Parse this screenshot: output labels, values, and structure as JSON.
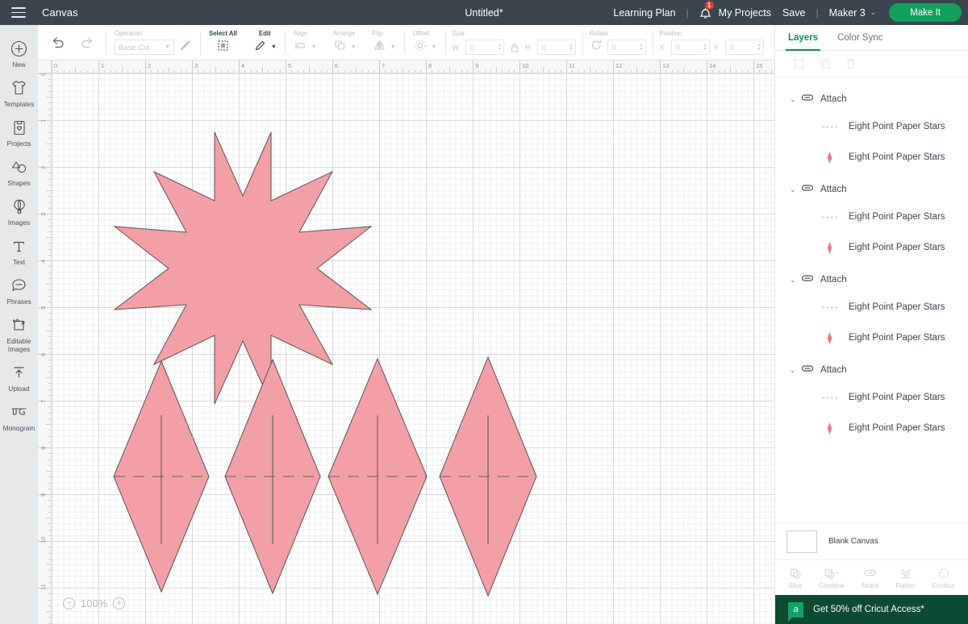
{
  "topbar": {
    "menu_icon": "hamburger-icon",
    "canvas_label": "Canvas",
    "title": "Untitled*",
    "learning_plan": "Learning Plan",
    "separator": "|",
    "bell_icon": "notification-bell-icon",
    "badge_count": "1",
    "my_projects": "My Projects",
    "save": "Save",
    "separator2": "|",
    "machine": "Maker 3",
    "chevron": "⌄",
    "make_it": "Make It",
    "bg_color": "#3c444d",
    "accent_green": "#12a05c"
  },
  "rail": {
    "items": [
      {
        "label": "New",
        "icon": "plus-circle-icon"
      },
      {
        "label": "Templates",
        "icon": "tshirt-icon"
      },
      {
        "label": "Projects",
        "icon": "projects-card-icon"
      },
      {
        "label": "Shapes",
        "icon": "shapes-icon"
      },
      {
        "label": "Images",
        "icon": "hot-air-balloon-icon"
      },
      {
        "label": "Text",
        "icon": "text-t-icon"
      },
      {
        "label": "Phrases",
        "icon": "speech-bubble-icon"
      },
      {
        "label": "Editable Images",
        "icon": "editable-images-icon"
      },
      {
        "label": "Upload",
        "icon": "upload-arrow-icon"
      },
      {
        "label": "Monogram",
        "icon": "monogram-icon"
      }
    ]
  },
  "toolbar": {
    "undo_icon": "undo-arrow-icon",
    "redo_icon": "redo-arrow-icon",
    "operation": {
      "label": "Operation",
      "value": "Basic Cut",
      "swatch_icon": "pen-stroke-icon"
    },
    "select_all": {
      "label": "Select All",
      "icon": "select-all-icon"
    },
    "edit": {
      "label": "Edit",
      "icon": "pencil-icon"
    },
    "align": {
      "label": "Align",
      "icon": "align-icon"
    },
    "arrange": {
      "label": "Arrange",
      "icon": "arrange-icon"
    },
    "flip": {
      "label": "Flip",
      "icon": "flip-icon"
    },
    "offset": {
      "label": "Offset",
      "icon": "offset-icon"
    },
    "size": {
      "label": "Size",
      "lock_icon": "lock-icon",
      "w_label": "W",
      "w_value": "0",
      "h_label": "H",
      "h_value": "0"
    },
    "rotate": {
      "label": "Rotate",
      "icon": "rotate-icon",
      "value": "0"
    },
    "position": {
      "label": "Position",
      "x_label": "X",
      "x_value": "0",
      "y_label": "Y",
      "y_value": "0"
    }
  },
  "canvas": {
    "zoom_level": "100%",
    "zoom_out_icon": "minus-circle-icon",
    "zoom_in_icon": "plus-circle-icon",
    "ruler_h_labels": [
      "0",
      "1",
      "2",
      "3",
      "4",
      "5",
      "6",
      "7",
      "8",
      "9",
      "10",
      "11",
      "12",
      "13",
      "14",
      "15"
    ],
    "ruler_v_labels": [
      "0",
      "1",
      "2",
      "3",
      "4",
      "5",
      "6",
      "7",
      "8",
      "9",
      "10",
      "11"
    ],
    "shape_fill": "#f2a0a6",
    "shape_stroke": "#6a5a5c",
    "score_line_color": "#6a5a5c"
  },
  "rightpanel": {
    "tabs": [
      {
        "label": "Layers",
        "selected": true
      },
      {
        "label": "Color Sync",
        "selected": false
      }
    ],
    "panel_tools": [
      "group-icon",
      "duplicate-icon",
      "delete-trash-icon"
    ],
    "groups": [
      {
        "label": "Attach",
        "chevron": "⌄",
        "icon": "attach-paperclip-icon",
        "layers": [
          {
            "label": "Eight Point Paper Stars",
            "icon": "score-dashed-line-icon"
          },
          {
            "label": "Eight Point Paper Stars",
            "icon": "diamond-shape-icon"
          }
        ]
      },
      {
        "label": "Attach",
        "chevron": "⌄",
        "icon": "attach-paperclip-icon",
        "layers": [
          {
            "label": "Eight Point Paper Stars",
            "icon": "score-dashed-line-icon"
          },
          {
            "label": "Eight Point Paper Stars",
            "icon": "diamond-shape-icon"
          }
        ]
      },
      {
        "label": "Attach",
        "chevron": "⌄",
        "icon": "attach-paperclip-icon",
        "layers": [
          {
            "label": "Eight Point Paper Stars",
            "icon": "score-dashed-line-icon"
          },
          {
            "label": "Eight Point Paper Stars",
            "icon": "diamond-shape-icon"
          }
        ]
      },
      {
        "label": "Attach",
        "chevron": "⌄",
        "icon": "attach-paperclip-icon",
        "layers": [
          {
            "label": "Eight Point Paper Stars",
            "icon": "score-dashed-line-icon"
          },
          {
            "label": "Eight Point Paper Stars",
            "icon": "diamond-shape-icon"
          }
        ]
      }
    ],
    "blank_canvas": {
      "label": "Blank Canvas"
    },
    "bottom_tools": [
      {
        "label": "Slice",
        "icon": "slice-icon"
      },
      {
        "label": "Combine",
        "icon": "combine-icon",
        "has_caret": true
      },
      {
        "label": "Attach",
        "icon": "attach-paperclip-icon"
      },
      {
        "label": "Flatten",
        "icon": "flatten-icon"
      },
      {
        "label": "Contour",
        "icon": "contour-icon"
      }
    ],
    "promo": {
      "text": "Get 50% off Cricut Access*",
      "logo": "cricut-a-logo",
      "bg": "#0c4a33"
    }
  }
}
